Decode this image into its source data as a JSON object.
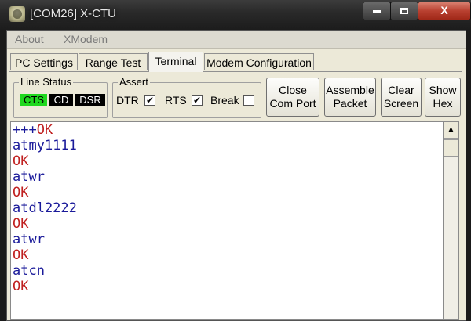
{
  "window": {
    "title": "[COM26] X-CTU",
    "min_glyph": "",
    "max_glyph": "",
    "close_glyph": "X"
  },
  "menu": {
    "items": [
      "About",
      "XModem"
    ]
  },
  "tabs": [
    {
      "label": "PC Settings",
      "active": false
    },
    {
      "label": "Range Test",
      "active": false
    },
    {
      "label": "Terminal",
      "active": true
    },
    {
      "label": "Modem Configuration",
      "active": false
    }
  ],
  "line_status": {
    "label": "Line Status",
    "indicators": [
      {
        "label": "CTS",
        "color": "#1fd81f",
        "on": true
      },
      {
        "label": "CD",
        "on": false
      },
      {
        "label": "DSR",
        "on": false
      }
    ]
  },
  "assert": {
    "label": "Assert",
    "items": [
      {
        "label": "DTR",
        "checked": true,
        "mark": "✔"
      },
      {
        "label": "RTS",
        "checked": true,
        "mark": "✔"
      },
      {
        "label": "Break",
        "checked": false,
        "mark": ""
      }
    ]
  },
  "buttons": [
    {
      "line1": "Close",
      "line2": "Com Port"
    },
    {
      "line1": "Assemble",
      "line2": "Packet"
    },
    {
      "line1": "Clear",
      "line2": "Screen"
    },
    {
      "line1": "Show",
      "line2": "Hex"
    }
  ],
  "terminal": {
    "lines": [
      {
        "text": "+++",
        "color": "blue",
        "suffix": "OK",
        "suffix_color": "red"
      },
      {
        "text": "atmy1111",
        "color": "blue"
      },
      {
        "text": "OK",
        "color": "red"
      },
      {
        "text": "atwr",
        "color": "blue"
      },
      {
        "text": "OK",
        "color": "red"
      },
      {
        "text": "atdl2222",
        "color": "blue"
      },
      {
        "text": "OK",
        "color": "red"
      },
      {
        "text": "atwr",
        "color": "blue"
      },
      {
        "text": "OK",
        "color": "red"
      },
      {
        "text": "atcn",
        "color": "blue"
      },
      {
        "text": "OK",
        "color": "red"
      }
    ]
  },
  "scrollbar": {
    "up_glyph": "▲"
  }
}
